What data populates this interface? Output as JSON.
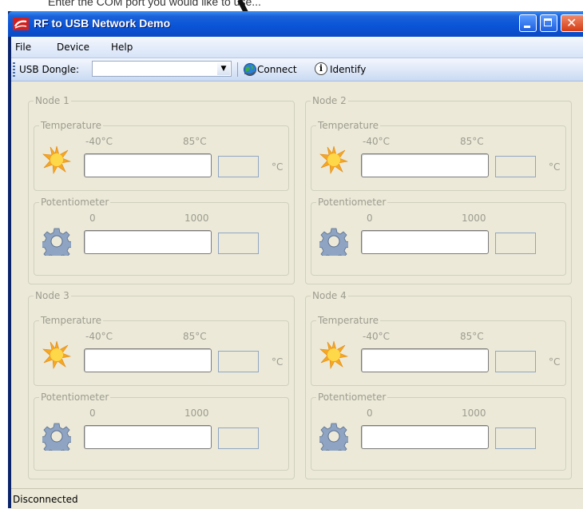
{
  "background": {
    "fragment_text": "Enter the COM port you would like to use..."
  },
  "window": {
    "title": "RF to USB Network Demo"
  },
  "menu": {
    "items": [
      "File",
      "Device",
      "Help"
    ]
  },
  "toolbar": {
    "dongle_label": "USB Dongle:",
    "dongle_value": "",
    "connect_label": "Connect",
    "identify_label": "Identify"
  },
  "nodes": [
    {
      "title": "Node 1",
      "temp_label": "Temperature",
      "temp_min": "-40°C",
      "temp_max": "85°C",
      "temp_unit": "°C",
      "pot_label": "Potentiometer",
      "pot_min": "0",
      "pot_max": "1000"
    },
    {
      "title": "Node 2",
      "temp_label": "Temperature",
      "temp_min": "-40°C",
      "temp_max": "85°C",
      "temp_unit": "°C",
      "pot_label": "Potentiometer",
      "pot_min": "0",
      "pot_max": "1000"
    },
    {
      "title": "Node 3",
      "temp_label": "Temperature",
      "temp_min": "-40°C",
      "temp_max": "85°C",
      "temp_unit": "°C",
      "pot_label": "Potentiometer",
      "pot_min": "0",
      "pot_max": "1000"
    },
    {
      "title": "Node 4",
      "temp_label": "Temperature",
      "temp_min": "-40°C",
      "temp_max": "85°C",
      "temp_unit": "°C",
      "pot_label": "Potentiometer",
      "pot_min": "0",
      "pot_max": "1000"
    }
  ],
  "status": {
    "text": "Disconnected"
  },
  "colors": {
    "title_blue": "#0a55d8",
    "client_bg": "#ece9d8",
    "disabled_text": "#9c9c8f"
  }
}
